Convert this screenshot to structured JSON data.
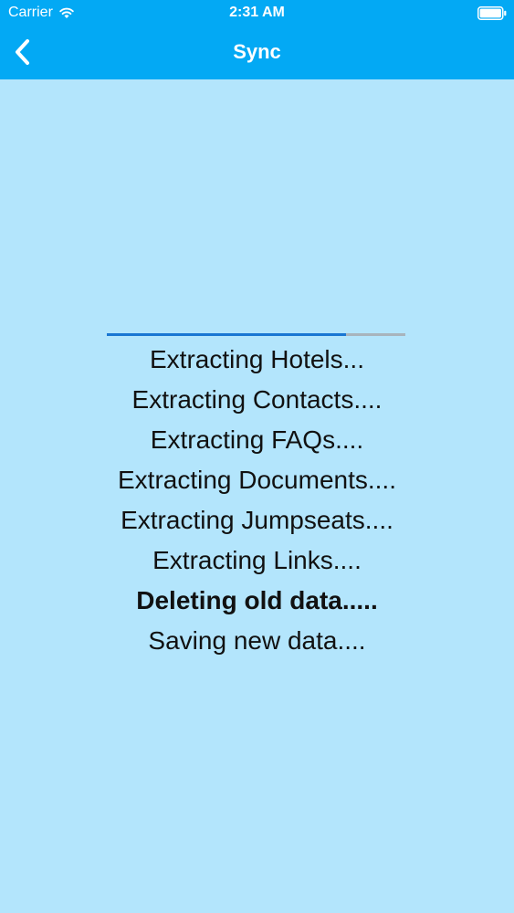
{
  "status_bar": {
    "carrier": "Carrier",
    "time": "2:31 AM"
  },
  "nav": {
    "title": "Sync",
    "back_icon": "chevron-left-icon"
  },
  "progress": {
    "fraction": 0.8
  },
  "log": [
    {
      "text": "Extracting Hotels...",
      "active": false
    },
    {
      "text": "Extracting Contacts....",
      "active": false
    },
    {
      "text": "Extracting FAQs....",
      "active": false
    },
    {
      "text": "Extracting Documents....",
      "active": false
    },
    {
      "text": "Extracting Jumpseats....",
      "active": false
    },
    {
      "text": "Extracting Links....",
      "active": false
    },
    {
      "text": "Deleting old data.....",
      "active": true
    },
    {
      "text": "Saving new data....",
      "active": false
    }
  ],
  "colors": {
    "header": "#03a9f4",
    "background": "#b3e5fc",
    "progress_fill": "#1976d2",
    "progress_track": "#a8b4bc"
  }
}
